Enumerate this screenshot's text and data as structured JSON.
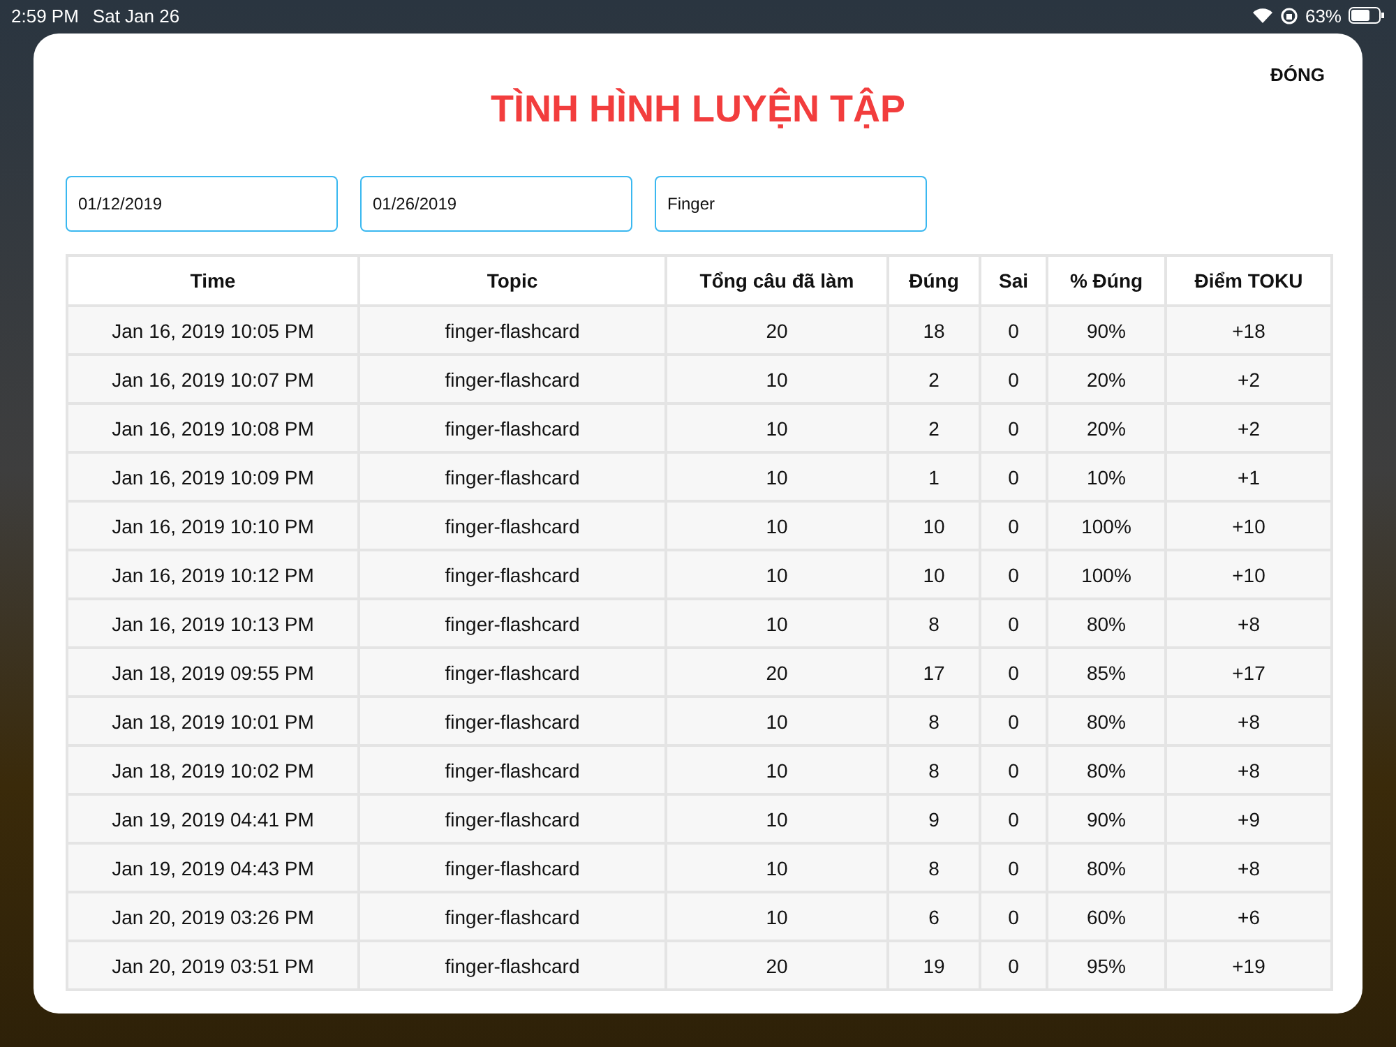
{
  "status_bar": {
    "time": "2:59 PM",
    "date": "Sat Jan 26",
    "battery": "63%"
  },
  "dialog": {
    "title": "TÌNH HÌNH LUYỆN TẬP",
    "close": "ĐÓNG"
  },
  "filters": [
    {
      "value": "01/12/2019"
    },
    {
      "value": "01/26/2019"
    },
    {
      "value": "Finger"
    }
  ],
  "table": {
    "columns": [
      "Time",
      "Topic",
      "Tổng câu đã làm",
      "Đúng",
      "Sai",
      "% Đúng",
      "Điểm TOKU"
    ],
    "rows": [
      [
        "Jan 16, 2019 10:05 PM",
        "finger-flashcard",
        "20",
        "18",
        "0",
        "90%",
        "+18"
      ],
      [
        "Jan 16, 2019 10:07 PM",
        "finger-flashcard",
        "10",
        "2",
        "0",
        "20%",
        "+2"
      ],
      [
        "Jan 16, 2019 10:08 PM",
        "finger-flashcard",
        "10",
        "2",
        "0",
        "20%",
        "+2"
      ],
      [
        "Jan 16, 2019 10:09 PM",
        "finger-flashcard",
        "10",
        "1",
        "0",
        "10%",
        "+1"
      ],
      [
        "Jan 16, 2019 10:10 PM",
        "finger-flashcard",
        "10",
        "10",
        "0",
        "100%",
        "+10"
      ],
      [
        "Jan 16, 2019 10:12 PM",
        "finger-flashcard",
        "10",
        "10",
        "0",
        "100%",
        "+10"
      ],
      [
        "Jan 16, 2019 10:13 PM",
        "finger-flashcard",
        "10",
        "8",
        "0",
        "80%",
        "+8"
      ],
      [
        "Jan 18, 2019 09:55 PM",
        "finger-flashcard",
        "20",
        "17",
        "0",
        "85%",
        "+17"
      ],
      [
        "Jan 18, 2019 10:01 PM",
        "finger-flashcard",
        "10",
        "8",
        "0",
        "80%",
        "+8"
      ],
      [
        "Jan 18, 2019 10:02 PM",
        "finger-flashcard",
        "10",
        "8",
        "0",
        "80%",
        "+8"
      ],
      [
        "Jan 19, 2019 04:41 PM",
        "finger-flashcard",
        "10",
        "9",
        "0",
        "90%",
        "+9"
      ],
      [
        "Jan 19, 2019 04:43 PM",
        "finger-flashcard",
        "10",
        "8",
        "0",
        "80%",
        "+8"
      ],
      [
        "Jan 20, 2019 03:26 PM",
        "finger-flashcard",
        "10",
        "6",
        "0",
        "60%",
        "+6"
      ],
      [
        "Jan 20, 2019 03:51 PM",
        "finger-flashcard",
        "20",
        "19",
        "0",
        "95%",
        "+19"
      ]
    ]
  }
}
